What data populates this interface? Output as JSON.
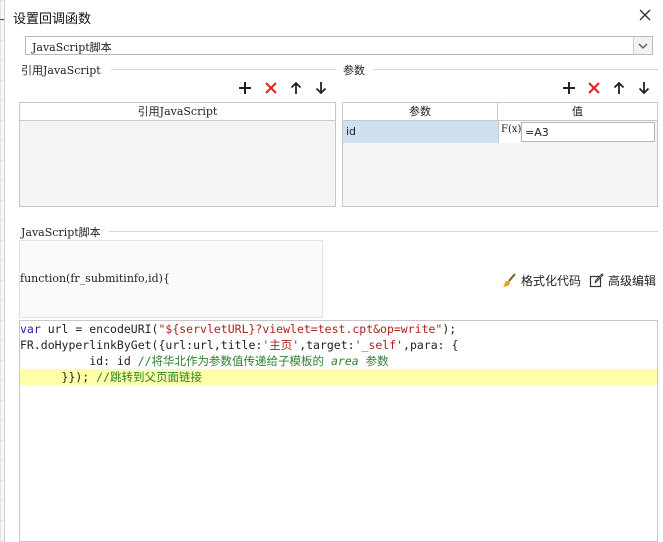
{
  "dialog": {
    "title": "设置回调函数",
    "left_stub": "_"
  },
  "script_type": {
    "selected": "JavaScript脚本"
  },
  "ref_js": {
    "group_label": "引用JavaScript",
    "column_header": "引用JavaScript"
  },
  "params": {
    "group_label": "参数",
    "columns": [
      "参数",
      "值"
    ],
    "rows": [
      {
        "name": "id",
        "formula_icon": "F(x)",
        "value": "=A3"
      }
    ]
  },
  "script": {
    "group_label": "JavaScript脚本",
    "signature": "function(fr_submitinfo,id){",
    "format_label": "格式化代码",
    "advanced_label": "高级编辑",
    "code": {
      "l1_kw": "var",
      "l1_a": " url = encodeURI(",
      "l1_str": "\"${servletURL}?viewlet=test.cpt&op=write\"",
      "l1_b": ");",
      "l2_a": "FR.doHyperlinkByGet({url:url,title:",
      "l2_str1": "'主页'",
      "l2_b": ",target:",
      "l2_str2": "'_self'",
      "l2_c": ",para: {",
      "l3_a": "          id: id ",
      "l3_cm1": "//将华北作为参数值传递给子模板的 ",
      "l3_cmi": "area",
      "l3_cm2": " 参数",
      "l4_a": "      }}); ",
      "l4_cm": "//跳转到父页面链接"
    }
  },
  "icons": {
    "add": "plus-icon",
    "delete": "red-x-icon",
    "up": "arrow-up-icon",
    "down": "arrow-down-icon",
    "close": "close-icon",
    "format": "brush-icon",
    "edit": "edit-icon",
    "delete_color": "#e02020",
    "line_highlight": "#ffffaa",
    "param_cell_bg": "#cfe0ef"
  }
}
